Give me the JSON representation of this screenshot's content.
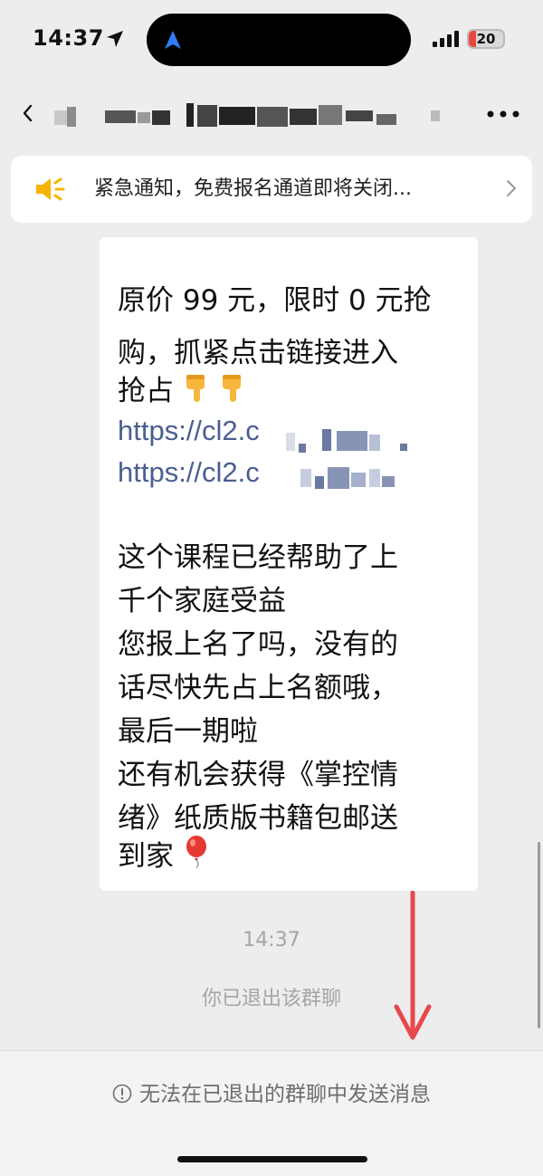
{
  "status_bar": {
    "time": "14:37",
    "battery_level": "20",
    "battery_fraction": 0.2
  },
  "notice": {
    "text": "紧急通知，免费报名通道即将关闭..."
  },
  "message": {
    "lines": [
      "原价 99 元，限时 0 元抢",
      "购，抓紧点击链接进入",
      "抢占",
      "https://cl2.c",
      "https://cl2.c",
      "这个课程已经帮助了上",
      "千个家庭受益",
      "您报上名了吗，没有的",
      "话尽快先占上名额哦，",
      "最后一期啦",
      "还有机会获得《掌控情",
      "绪》纸质版书籍包邮送",
      "到家"
    ]
  },
  "timestamp": "14:37",
  "system_message": "你已退出该群聊",
  "bottom_bar": {
    "message": "无法在已退出的群聊中发送消息"
  },
  "colors": {
    "background": "#ededed",
    "link": "#4a5f90",
    "annotation_arrow": "#e8474c",
    "notice_icon": "#f5b400"
  }
}
